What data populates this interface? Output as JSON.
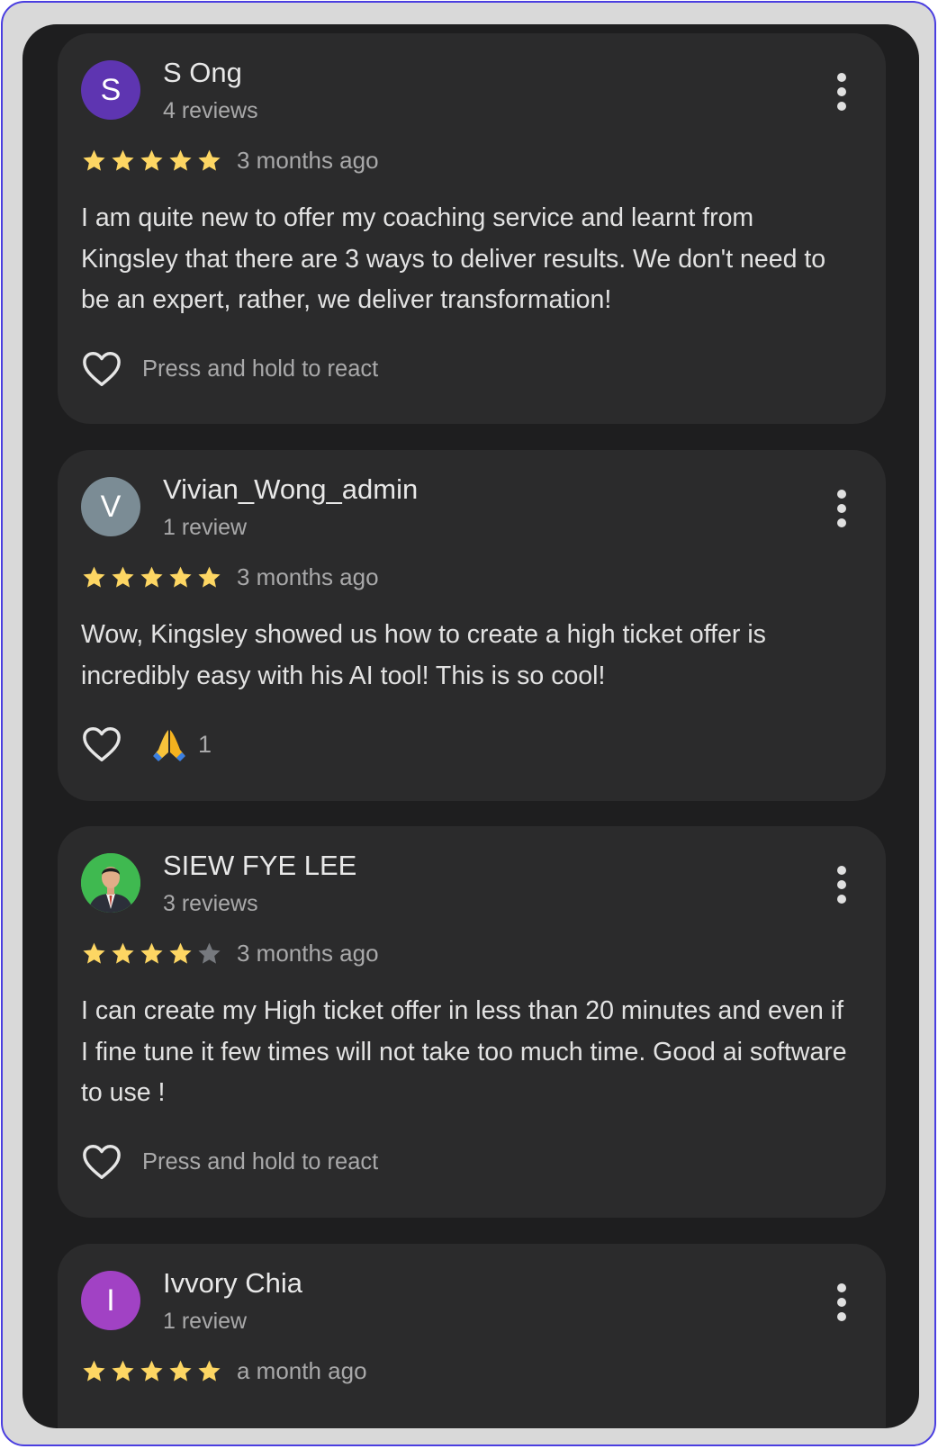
{
  "reviews": [
    {
      "initial": "S",
      "avatar_color": "#5e35b1",
      "name": "S Ong",
      "review_count": "4 reviews",
      "rating": 5,
      "time": "3 months ago",
      "text": "I am quite new to offer my coaching service and learnt from Kingsley that there are 3 ways to deliver results. We don't need to be an expert, rather, we deliver transformation!",
      "react_text": "Press and hold to react"
    },
    {
      "initial": "V",
      "avatar_color": "#7b8c95",
      "name": "Vivian_Wong_admin",
      "review_count": "1 review",
      "rating": 5,
      "time": "3 months ago",
      "text": "Wow, Kingsley showed us how to create a high ticket offer is incredibly easy with his AI tool! This is so cool!",
      "reaction_emoji": "folded-hands-icon",
      "reaction_count": "1"
    },
    {
      "avatar_color": "#3fb950",
      "name": "SIEW FYE LEE",
      "review_count": "3 reviews",
      "rating": 4,
      "time": "3 months ago",
      "text": "I can create my High ticket offer in less than 20 minutes and even if I fine tune it few times will not take too much time. Good ai software to use !",
      "react_text": "Press and hold to react"
    },
    {
      "initial": "I",
      "avatar_color": "#a142c4",
      "name": "Ivvory Chia",
      "review_count": "1 review",
      "rating": 5,
      "time": "a month ago"
    }
  ],
  "colors": {
    "star_filled": "#fdd663",
    "star_empty": "#76797e",
    "background": "#1e1e1f",
    "card": "#2b2b2c"
  }
}
